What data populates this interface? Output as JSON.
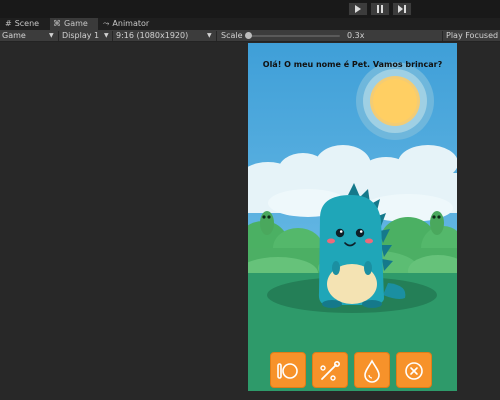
{
  "playbar": {
    "play_icon": "play-icon",
    "pause_icon": "pause-icon",
    "step_icon": "step-icon"
  },
  "tabs": [
    {
      "label": "Scene",
      "icon": "scene-grid-icon",
      "active": false
    },
    {
      "label": "Game",
      "icon": "game-controller-icon",
      "active": true
    },
    {
      "label": "Animator",
      "icon": "animator-icon",
      "active": false
    }
  ],
  "toolbar": {
    "view_mode": "Game",
    "display": "Display 1",
    "aspect": "9:16 (1080x1920)",
    "scale_label": "Scale",
    "scale_value": "0.3x",
    "play_focused": "Play Focused"
  },
  "game": {
    "dialog_text": "Olá! O meu nome é Pet. Vamos brincar?",
    "action_buttons": [
      {
        "name": "feed-button",
        "icon": "plate-icon"
      },
      {
        "name": "clean-button",
        "icon": "brush-icon"
      },
      {
        "name": "water-button",
        "icon": "water-drop-icon"
      },
      {
        "name": "cancel-button",
        "icon": "cancel-circle-icon"
      }
    ],
    "colors": {
      "sky": "#3fa0d6",
      "sun": "#ffd065",
      "grass": "#2e9a6a",
      "pet": "#1fa6b8",
      "button": "#f7922a"
    }
  }
}
